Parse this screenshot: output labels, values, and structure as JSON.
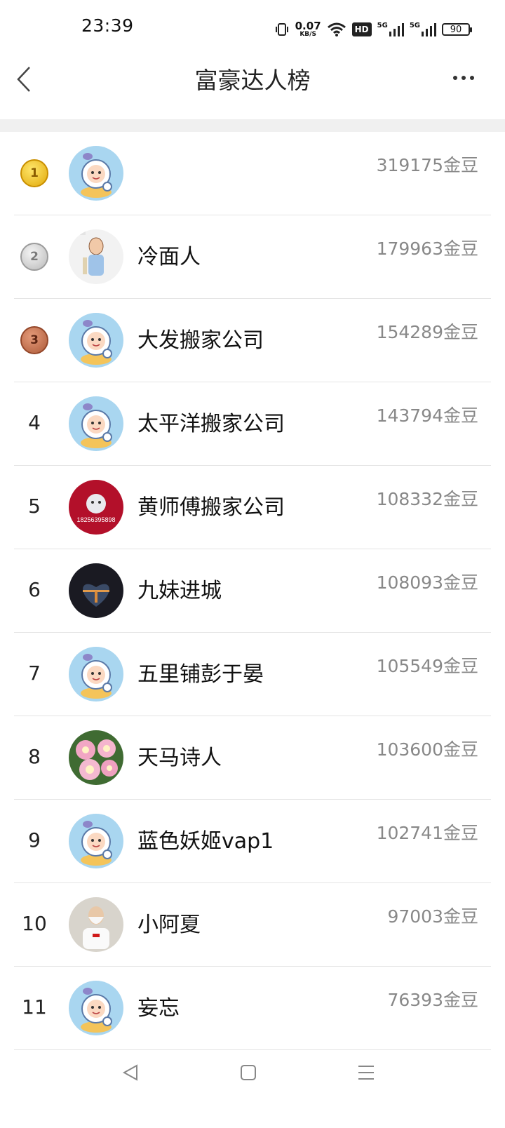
{
  "status_bar": {
    "time": "23:39",
    "net_speed_value": "0.07",
    "net_speed_unit": "KB/S",
    "hd_label": "HD",
    "signal_1_label": "5G",
    "signal_2_label": "5G",
    "battery": "90",
    "icons": [
      "vibrate-icon",
      "wifi-icon",
      "signal-icon",
      "battery-icon"
    ]
  },
  "header": {
    "title": "富豪达人榜",
    "back_icon": "chevron-left-icon",
    "more_icon": "more-dots-icon"
  },
  "leaderboard": [
    {
      "rank": "1",
      "medal": "gold",
      "name": "",
      "score": "319175金豆",
      "avatar": "astronaut-cartoon"
    },
    {
      "rank": "2",
      "medal": "silver",
      "name": "冷面人",
      "score": "179963金豆",
      "avatar": "cartoon-man"
    },
    {
      "rank": "3",
      "medal": "bronze",
      "name": "大发搬家公司",
      "score": "154289金豆",
      "avatar": "astronaut-cartoon"
    },
    {
      "rank": "4",
      "medal": "",
      "name": "太平洋搬家公司",
      "score": "143794金豆",
      "avatar": "astronaut-cartoon"
    },
    {
      "rank": "5",
      "medal": "",
      "name": "黄师傅搬家公司",
      "score": "108332金豆",
      "avatar": "red-logo",
      "avatar_text": "18256395898"
    },
    {
      "rank": "6",
      "medal": "",
      "name": "九妹进城",
      "score": "108093金豆",
      "avatar": "sunset-heart"
    },
    {
      "rank": "7",
      "medal": "",
      "name": "五里铺彭于晏",
      "score": "105549金豆",
      "avatar": "astronaut-cartoon"
    },
    {
      "rank": "8",
      "medal": "",
      "name": "天马诗人",
      "score": "103600金豆",
      "avatar": "pink-roses"
    },
    {
      "rank": "9",
      "medal": "",
      "name": "蓝色妖姬vap1",
      "score": "102741金豆",
      "avatar": "astronaut-cartoon"
    },
    {
      "rank": "10",
      "medal": "",
      "name": "小阿夏",
      "score": "97003金豆",
      "avatar": "white-beard-man"
    },
    {
      "rank": "11",
      "medal": "",
      "name": "妄忘",
      "score": "76393金豆",
      "avatar": "astronaut-cartoon"
    }
  ],
  "colors": {
    "score_text": "#888888",
    "divider": "#e4e4e4",
    "band": "#f0f0f0",
    "gold": "#e1a90a",
    "silver": "#b9b9b9",
    "bronze": "#ad5a39"
  },
  "nav_bar": {
    "icons": [
      "back-triangle-icon",
      "home-square-icon",
      "menu-lines-icon"
    ]
  }
}
